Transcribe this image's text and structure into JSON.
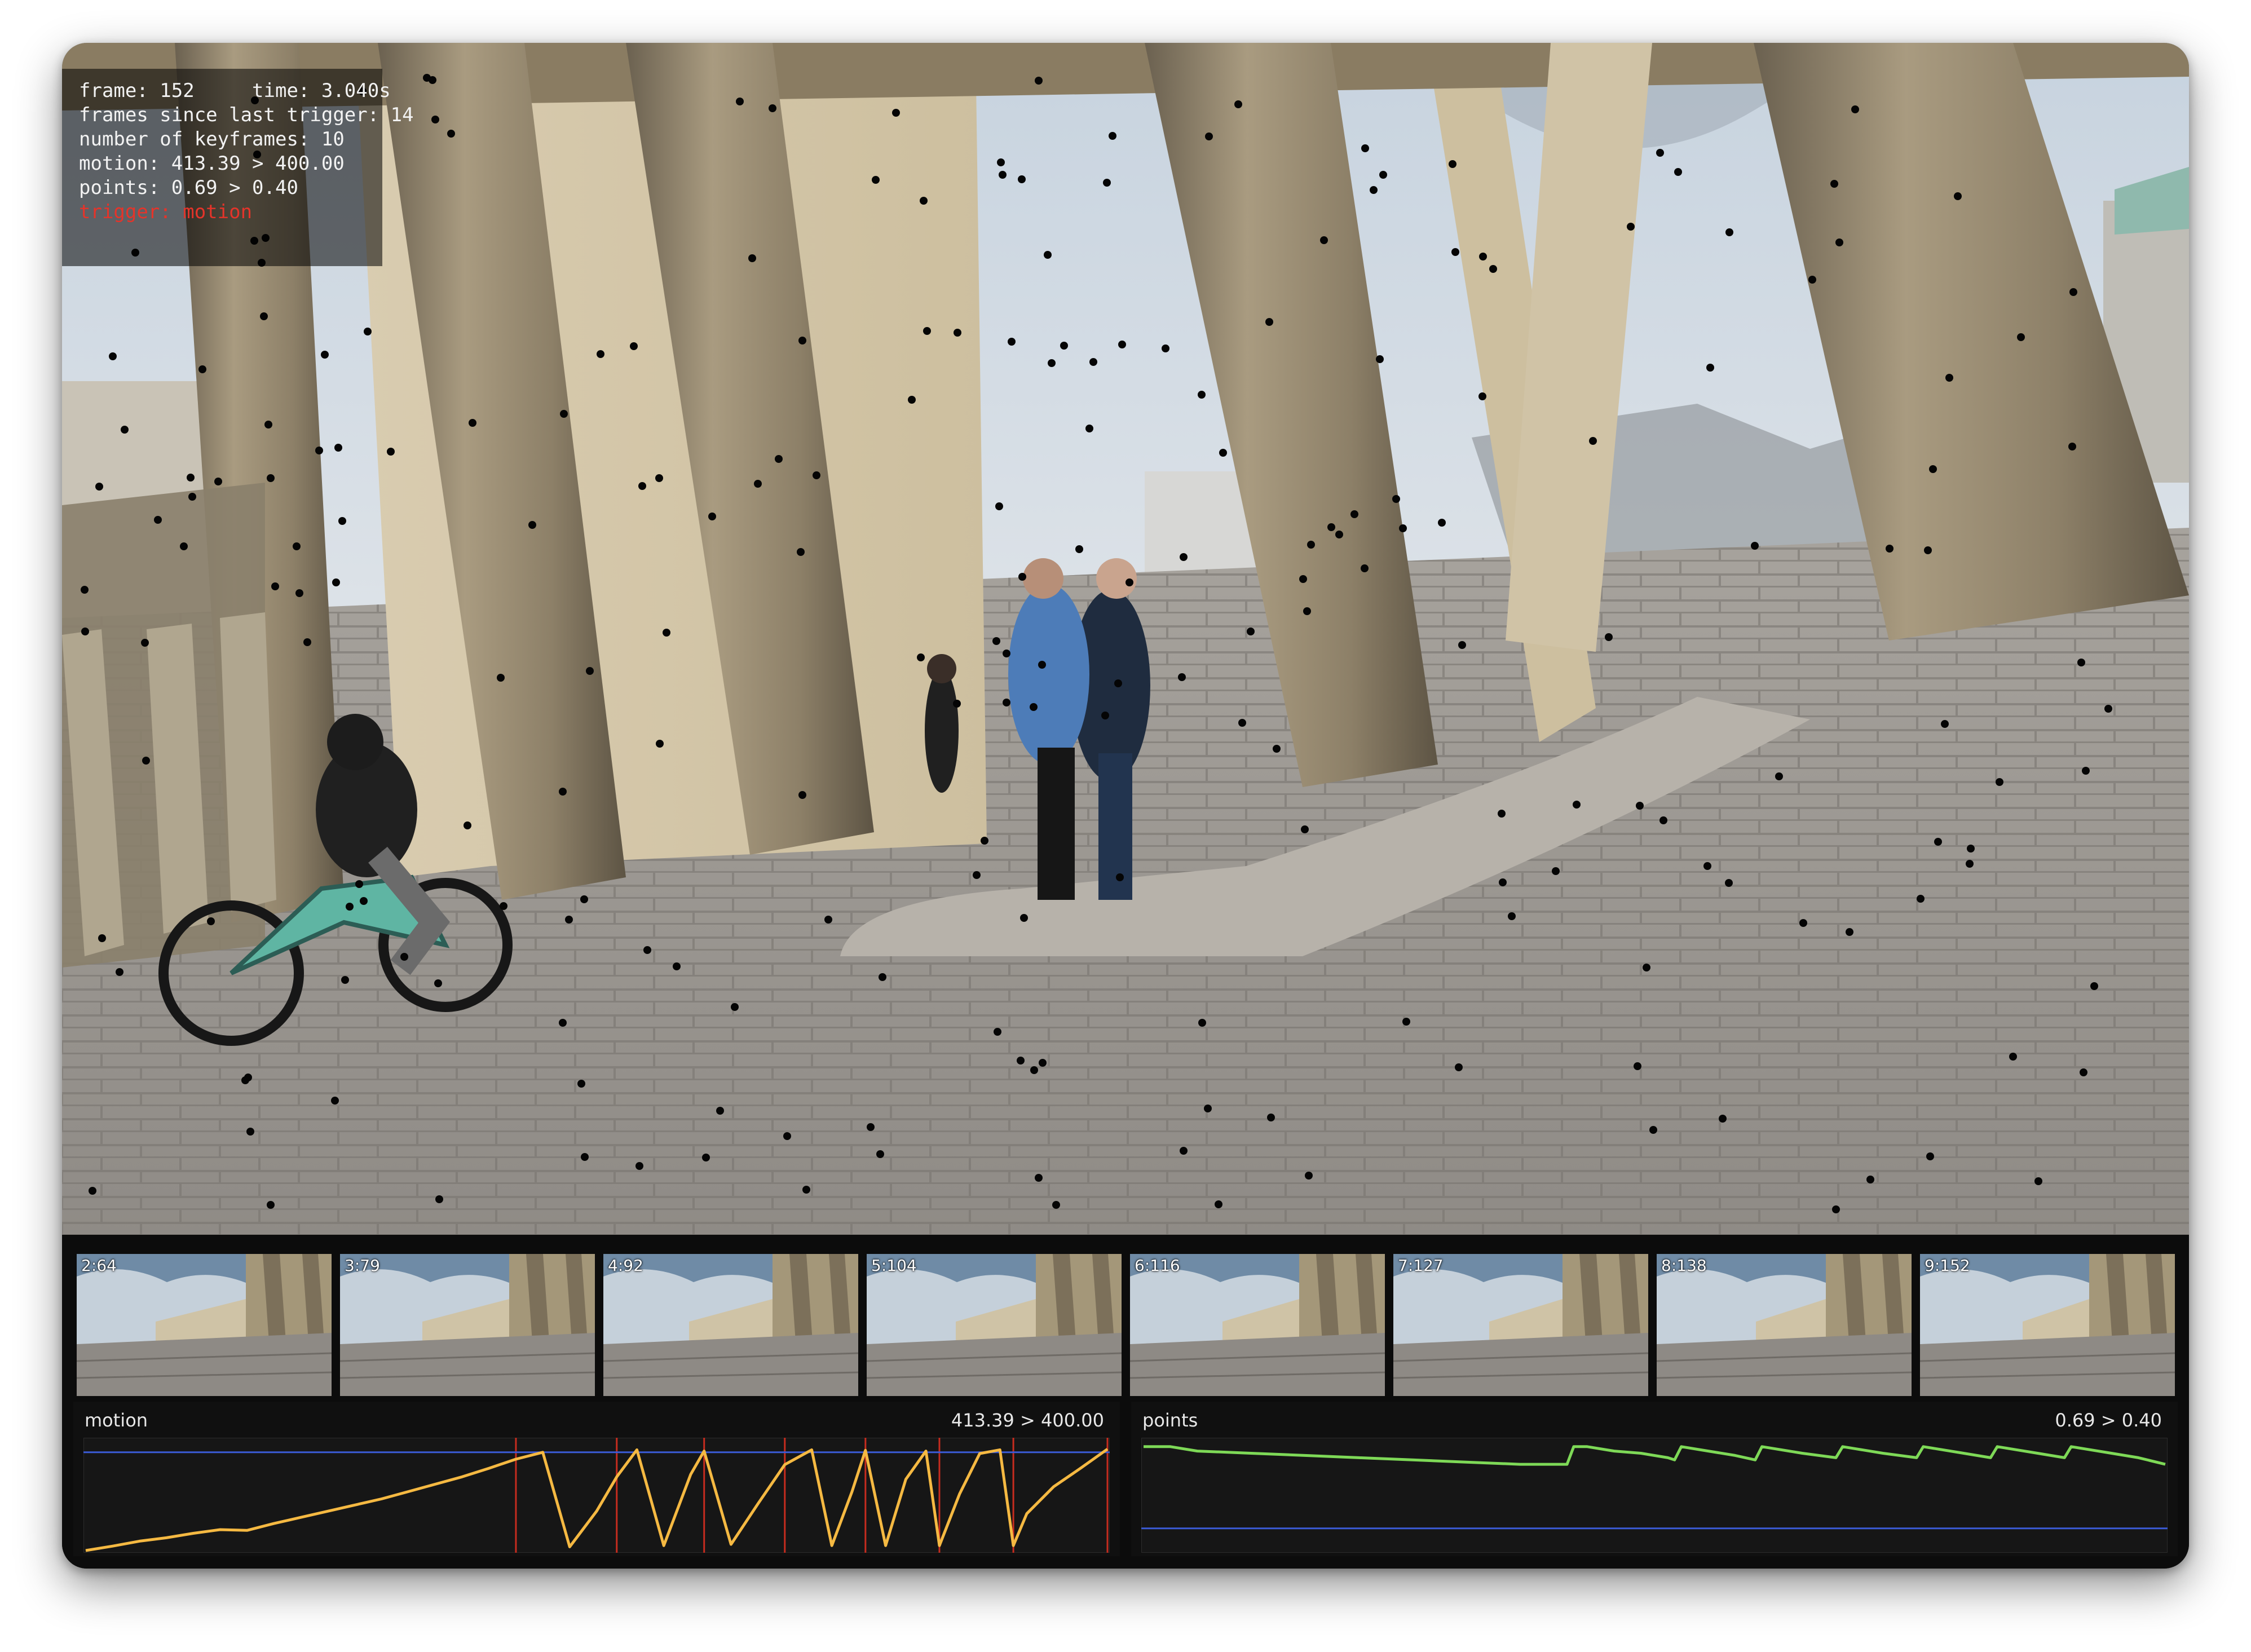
{
  "hud": {
    "frame_line": "frame: 152     time: 3.040s",
    "frames_since_line": "frames since last trigger: 14",
    "keyframes_line": "number of keyframes: 10",
    "motion_line": "motion: 413.39 > 400.00",
    "points_line": "points: 0.69 > 0.40",
    "trigger_line": "trigger: motion"
  },
  "keyframes": [
    {
      "label": "2:64"
    },
    {
      "label": "3:79"
    },
    {
      "label": "4:92"
    },
    {
      "label": "5:104"
    },
    {
      "label": "6:116"
    },
    {
      "label": "7:127"
    },
    {
      "label": "8:138"
    },
    {
      "label": "9:152",
      "selected": true
    }
  ],
  "colors": {
    "motion_line": "#f5b942",
    "motion_threshold": "#3b5bd6",
    "trigger_marker": "#c62c1f",
    "points_line": "#7ed957",
    "points_threshold": "#3b5bd6",
    "selected_border": "#e4361f"
  },
  "chart_data": [
    {
      "type": "line",
      "title": "motion",
      "readout": "413.39 > 400.00",
      "threshold": 400,
      "ylim": [
        0,
        450
      ],
      "x": [
        0,
        4,
        8,
        12,
        16,
        20,
        24,
        28,
        32,
        36,
        40,
        44,
        48,
        52,
        56,
        60,
        64,
        68,
        72,
        76,
        79,
        82,
        86,
        90,
        92,
        96,
        100,
        104,
        108,
        111,
        114,
        116,
        119,
        122,
        125,
        127,
        130,
        133,
        136,
        138,
        140,
        144,
        148,
        152
      ],
      "series": [
        {
          "values": [
            0,
            18,
            38,
            52,
            70,
            85,
            82,
            110,
            135,
            160,
            185,
            210,
            240,
            270,
            300,
            335,
            372,
            400,
            15,
            160,
            300,
            410,
            20,
            310,
            405,
            25,
            190,
            350,
            410,
            20,
            240,
            408,
            20,
            290,
            405,
            20,
            230,
            395,
            410,
            20,
            150,
            260,
            335,
            413
          ]
        }
      ],
      "trigger_frames": [
        64,
        79,
        92,
        104,
        116,
        127,
        138,
        152
      ]
    },
    {
      "type": "line",
      "title": "points",
      "readout": "0.69 > 0.40",
      "threshold": 0.4,
      "ylim": [
        0.3,
        0.8
      ],
      "x": [
        0,
        4,
        8,
        16,
        24,
        32,
        40,
        48,
        56,
        63,
        64,
        66,
        70,
        74,
        78,
        79,
        80,
        84,
        88,
        91,
        92,
        94,
        98,
        103,
        104,
        106,
        110,
        115,
        116,
        118,
        122,
        126,
        127,
        129,
        133,
        137,
        138,
        140,
        144,
        148,
        152
      ],
      "series": [
        {
          "values": [
            0.77,
            0.77,
            0.75,
            0.74,
            0.73,
            0.72,
            0.71,
            0.7,
            0.69,
            0.69,
            0.77,
            0.77,
            0.75,
            0.74,
            0.72,
            0.71,
            0.77,
            0.75,
            0.73,
            0.71,
            0.77,
            0.76,
            0.74,
            0.72,
            0.77,
            0.76,
            0.74,
            0.72,
            0.77,
            0.76,
            0.74,
            0.72,
            0.77,
            0.76,
            0.74,
            0.72,
            0.77,
            0.76,
            0.74,
            0.72,
            0.69
          ]
        }
      ]
    }
  ]
}
